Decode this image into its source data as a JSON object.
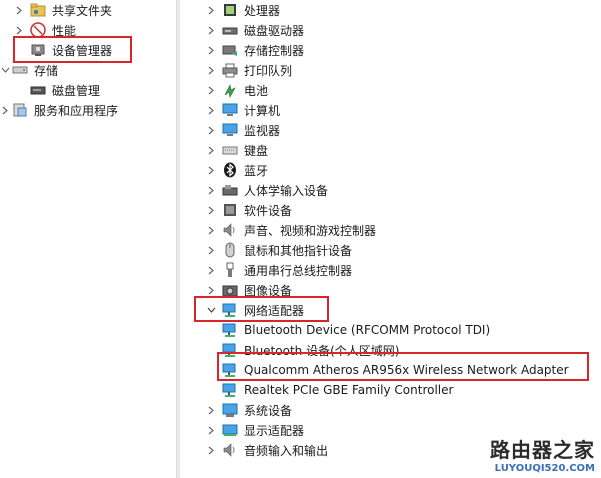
{
  "left_tree": [
    {
      "label": "共享文件夹",
      "icon": "shared-folder-icon"
    },
    {
      "label": "性能",
      "icon": "performance-icon"
    },
    {
      "label": "设备管理器",
      "icon": "device-manager-icon"
    },
    {
      "label": "存储",
      "icon": "storage-icon"
    },
    {
      "label": "磁盘管理",
      "icon": "disk-management-icon"
    },
    {
      "label": "服务和应用程序",
      "icon": "services-icon"
    }
  ],
  "device_tree": [
    {
      "label": "处理器",
      "icon": "processor-icon"
    },
    {
      "label": "磁盘驱动器",
      "icon": "disk-drive-icon"
    },
    {
      "label": "存储控制器",
      "icon": "storage-controller-icon"
    },
    {
      "label": "打印队列",
      "icon": "print-queue-icon"
    },
    {
      "label": "电池",
      "icon": "battery-icon"
    },
    {
      "label": "计算机",
      "icon": "computer-icon"
    },
    {
      "label": "监视器",
      "icon": "monitor-icon"
    },
    {
      "label": "键盘",
      "icon": "keyboard-icon"
    },
    {
      "label": "蓝牙",
      "icon": "bluetooth-icon"
    },
    {
      "label": "人体学输入设备",
      "icon": "hid-icon"
    },
    {
      "label": "软件设备",
      "icon": "software-device-icon"
    },
    {
      "label": "声音、视频和游戏控制器",
      "icon": "sound-icon"
    },
    {
      "label": "鼠标和其他指针设备",
      "icon": "mouse-icon"
    },
    {
      "label": "通用串行总线控制器",
      "icon": "usb-icon"
    },
    {
      "label": "图像设备",
      "icon": "camera-icon"
    },
    {
      "label": "网络适配器",
      "icon": "network-adapter-icon"
    },
    {
      "label": "Bluetooth Device (RFCOMM Protocol TDI)",
      "icon": "network-adapter-icon"
    },
    {
      "label": "Bluetooth 设备(个人区域网)",
      "icon": "network-adapter-icon"
    },
    {
      "label": "Qualcomm Atheros AR956x Wireless Network Adapter",
      "icon": "network-adapter-icon"
    },
    {
      "label": "Realtek PCIe GBE Family Controller",
      "icon": "network-adapter-icon"
    },
    {
      "label": "系统设备",
      "icon": "system-device-icon"
    },
    {
      "label": "显示适配器",
      "icon": "display-adapter-icon"
    },
    {
      "label": "音频输入和输出",
      "icon": "audio-io-icon"
    }
  ],
  "watermark": {
    "main": "路由器之家",
    "sub": "LUYOUQI520.COM"
  },
  "colors": {
    "highlight": "#d9262c",
    "network_icon": "#2f8fd8"
  }
}
